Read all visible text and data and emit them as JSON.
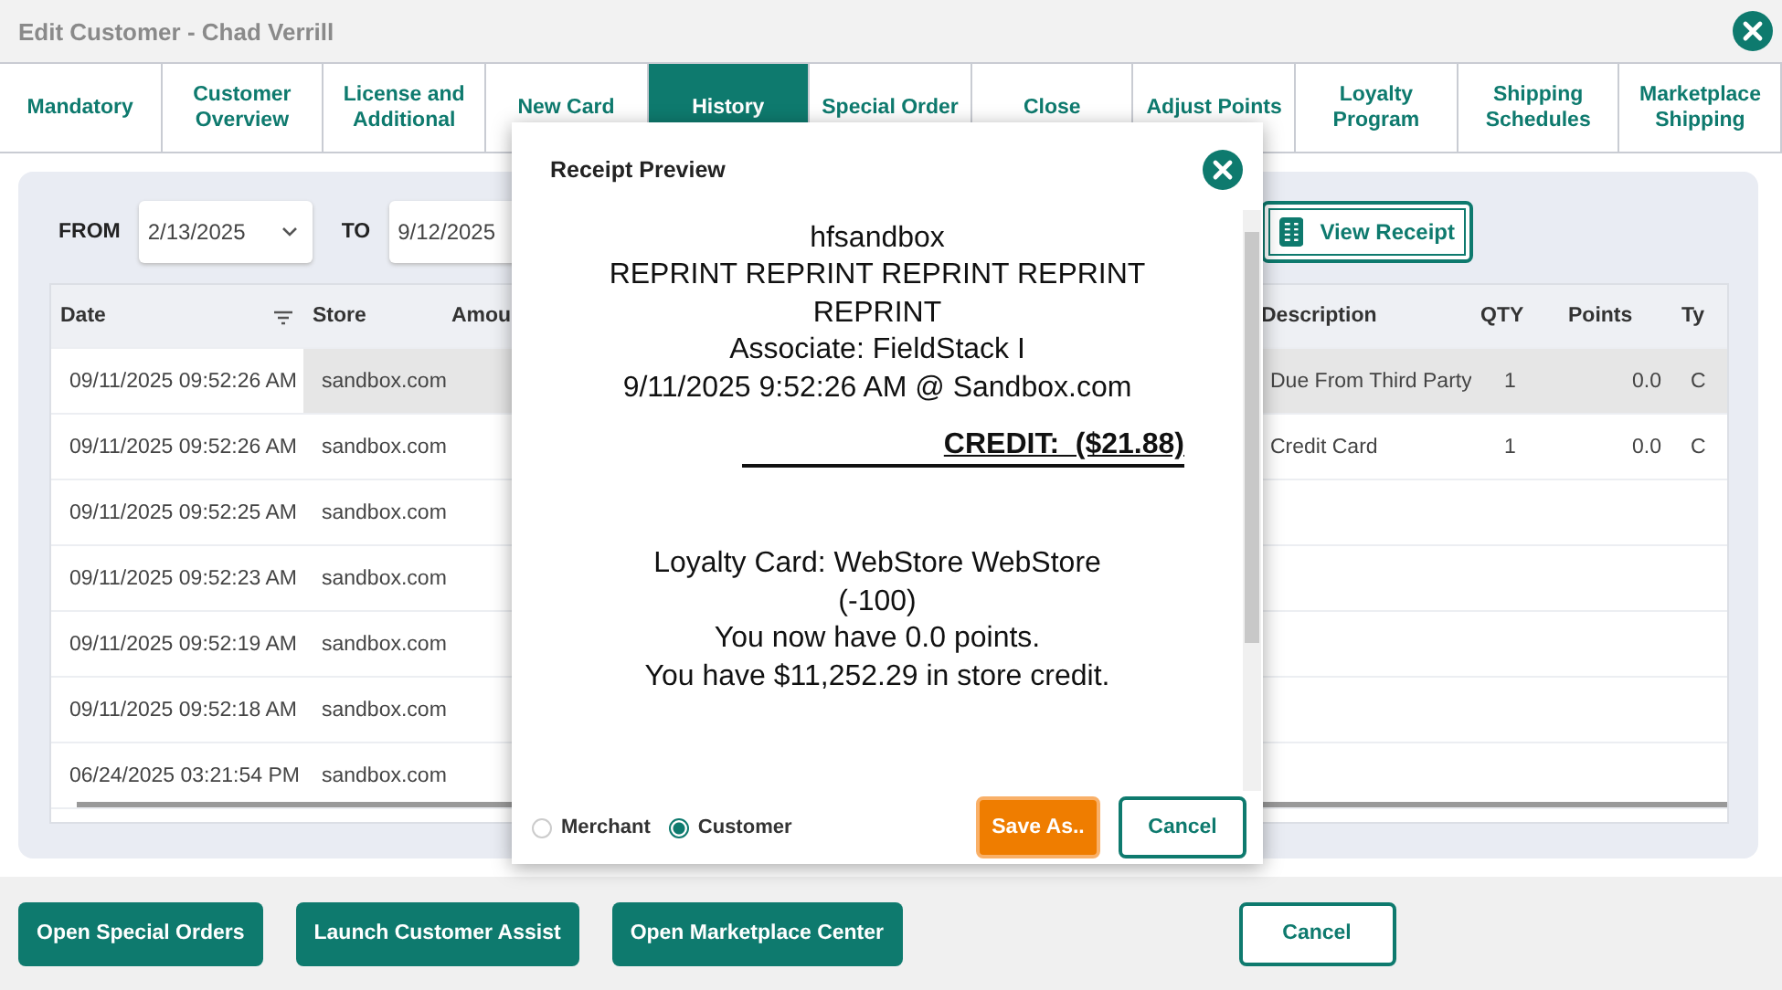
{
  "window": {
    "title": "Edit Customer - Chad Verrill"
  },
  "tabs": [
    {
      "label": "Mandatory",
      "selected": false
    },
    {
      "label": "Customer Overview",
      "selected": false
    },
    {
      "label": "License and Additional",
      "selected": false
    },
    {
      "label": "New Card",
      "selected": false
    },
    {
      "label": "History",
      "selected": true
    },
    {
      "label": "Special Order",
      "selected": false
    },
    {
      "label": "Close",
      "selected": false
    },
    {
      "label": "Adjust Points",
      "selected": false
    },
    {
      "label": "Loyalty Program",
      "selected": false
    },
    {
      "label": "Shipping Schedules",
      "selected": false
    },
    {
      "label": "Marketplace Shipping",
      "selected": false
    }
  ],
  "filter": {
    "from_label": "FROM",
    "from_value": "2/13/2025",
    "to_label": "TO",
    "to_value": "9/12/2025",
    "view_button": "View Receipt"
  },
  "table": {
    "left_columns": [
      "Date",
      "Store",
      "Amou"
    ],
    "right_columns": [
      "Description",
      "QTY",
      "Points",
      "Ty"
    ],
    "rows": [
      {
        "date": "09/11/2025 09:52:26 AM",
        "store": "sandbox.com",
        "description": "Due From Third Party",
        "qty": "1",
        "points": "0.0",
        "type": "C",
        "selected": true
      },
      {
        "date": "09/11/2025 09:52:26 AM",
        "store": "sandbox.com",
        "description": "Credit Card",
        "qty": "1",
        "points": "0.0",
        "type": "C",
        "selected": false
      },
      {
        "date": "09/11/2025 09:52:25 AM",
        "store": "sandbox.com",
        "selected": false
      },
      {
        "date": "09/11/2025 09:52:23 AM",
        "store": "sandbox.com",
        "selected": false
      },
      {
        "date": "09/11/2025 09:52:19 AM",
        "store": "sandbox.com",
        "selected": false
      },
      {
        "date": "09/11/2025 09:52:18 AM",
        "store": "sandbox.com",
        "selected": false
      },
      {
        "date": "06/24/2025 03:21:54 PM",
        "store": "sandbox.com",
        "selected": false
      }
    ]
  },
  "bottom_buttons": [
    {
      "label": "Open Special Orders",
      "kind": "primary"
    },
    {
      "label": "Launch Customer Assist",
      "kind": "primary"
    },
    {
      "label": "Open Marketplace Center",
      "kind": "primary"
    },
    {
      "label": "Cancel",
      "kind": "outline"
    }
  ],
  "dialog": {
    "title": "Receipt Preview",
    "lines": [
      {
        "kind": "text",
        "text": "hfsandbox"
      },
      {
        "kind": "text",
        "text": "REPRINT REPRINT REPRINT REPRINT REPRINT"
      },
      {
        "kind": "text",
        "text": "Associate: FieldStack I"
      },
      {
        "kind": "text",
        "text": "9/11/2025 9:52:26 AM @ Sandbox.com"
      },
      {
        "kind": "total",
        "text": "CREDIT:  ($21.88)"
      },
      {
        "kind": "text",
        "text": "Loyalty Card: WebStore WebStore"
      },
      {
        "kind": "text",
        "text": "(-100)"
      },
      {
        "kind": "text",
        "text": "You now have 0.0 points."
      },
      {
        "kind": "text",
        "text": "You have $11,252.29 in store credit."
      }
    ],
    "copies": [
      {
        "label": "Merchant",
        "selected": false
      },
      {
        "label": "Customer",
        "selected": true
      }
    ],
    "buttons": [
      {
        "label": "Save As..",
        "kind": "primary"
      },
      {
        "label": "Cancel",
        "kind": "outline"
      }
    ]
  }
}
